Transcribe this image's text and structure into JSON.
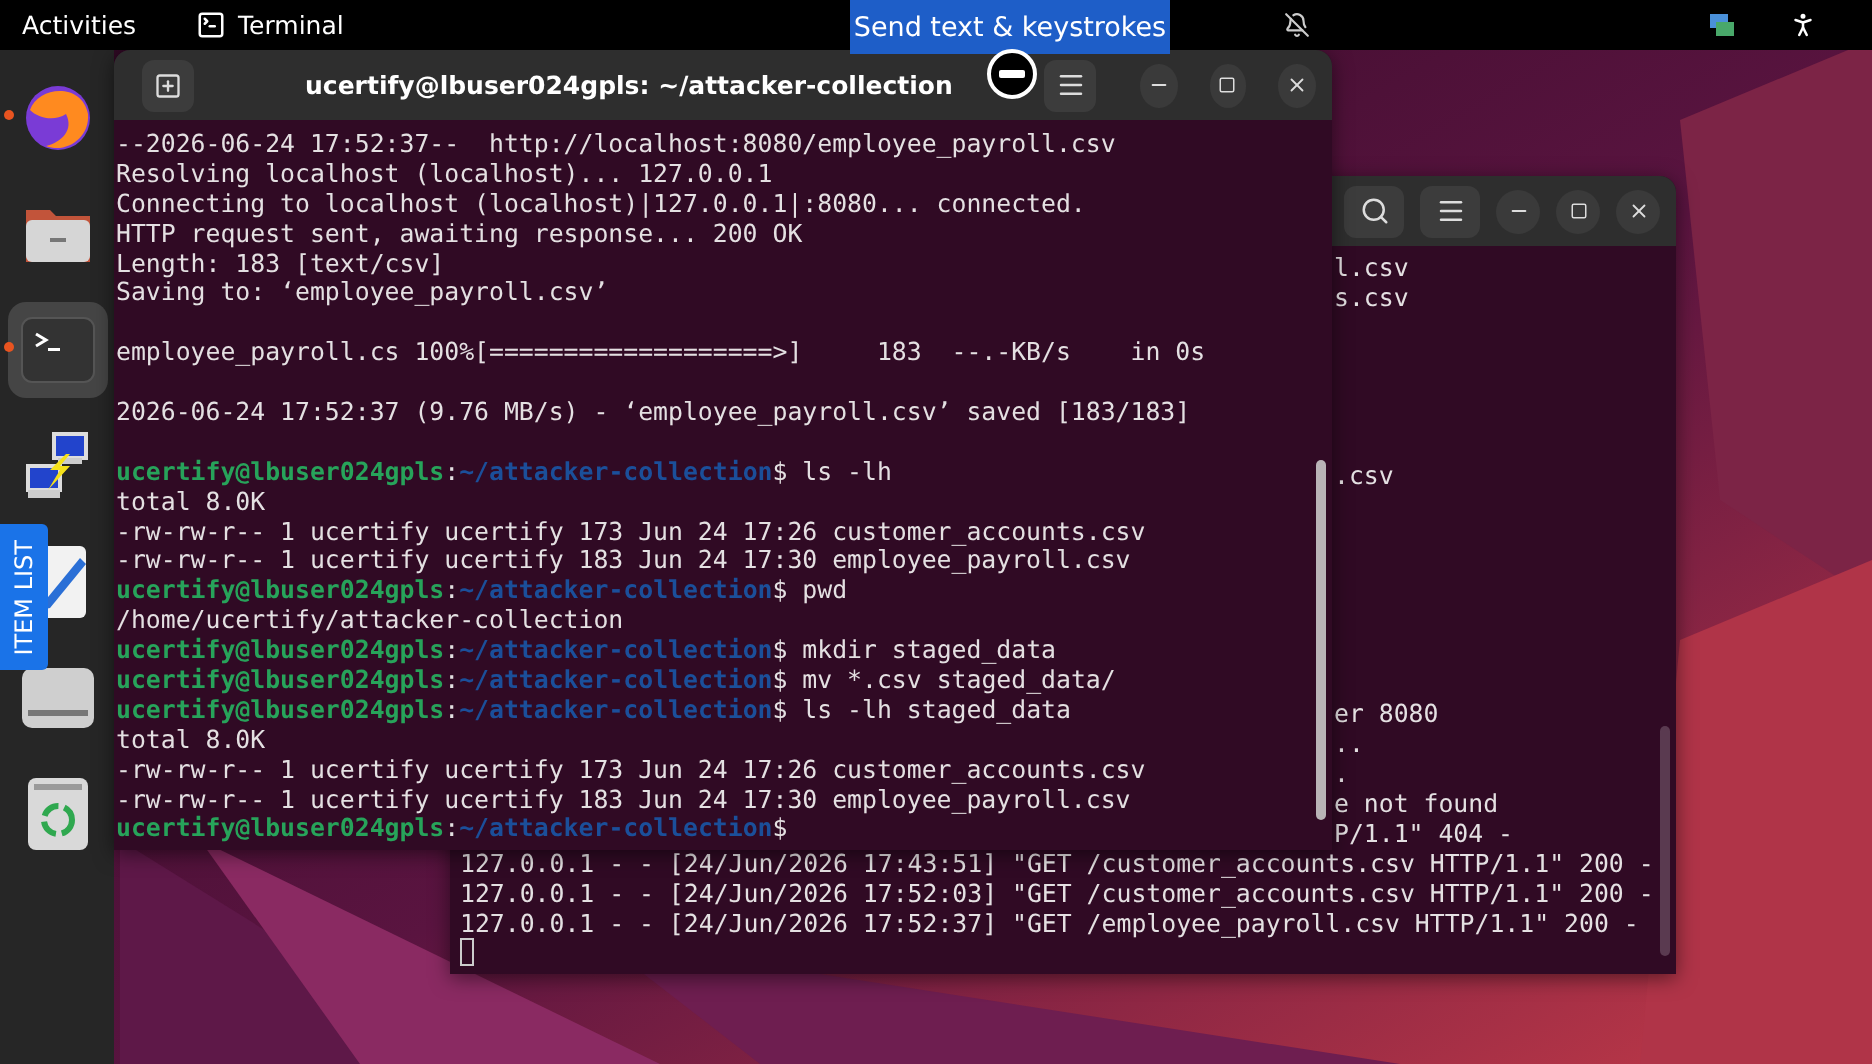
{
  "top_bar": {
    "activities": "Activities",
    "app_name": "Terminal"
  },
  "overlay": {
    "tooltip": "Send text & keystrokes",
    "side_tab": "ITEM LIST"
  },
  "dock": [
    {
      "kind": "browser",
      "running": true,
      "selected": false
    },
    {
      "kind": "folder",
      "running": false,
      "selected": false
    },
    {
      "kind": "terminal",
      "running": true,
      "selected": true
    },
    {
      "kind": "remote",
      "running": false,
      "selected": false
    },
    {
      "kind": "editor",
      "running": false,
      "selected": false
    },
    {
      "kind": "drive",
      "running": false,
      "selected": false
    },
    {
      "kind": "trash",
      "running": false,
      "selected": false
    }
  ],
  "front_terminal": {
    "title": "ucertify@lbuser024gpls: ~/attacker-collection",
    "lines": [
      {
        "kind": "output",
        "text": "--2026-06-24 17:52:37--  http://localhost:8080/employee_payroll.csv"
      },
      {
        "kind": "output",
        "text": "Resolving localhost (localhost)... 127.0.0.1"
      },
      {
        "kind": "output",
        "text": "Connecting to localhost (localhost)|127.0.0.1|:8080... connected."
      },
      {
        "kind": "output",
        "text": "HTTP request sent, awaiting response... 200 OK"
      },
      {
        "kind": "output",
        "text": "Length: 183 [text/csv]"
      },
      {
        "kind": "output",
        "text": "Saving to: ‘employee_payroll.csv’"
      },
      {
        "kind": "blank"
      },
      {
        "kind": "output",
        "text": "employee_payroll.cs 100%[===================>]     183  --.-KB/s    in 0s"
      },
      {
        "kind": "blank"
      },
      {
        "kind": "output",
        "text": "2026-06-24 17:52:37 (9.76 MB/s) - ‘employee_payroll.csv’ saved [183/183]"
      },
      {
        "kind": "blank"
      },
      {
        "kind": "prompt",
        "user": "ucertify@lbuser024gpls",
        "sep": ":",
        "path": "~/attacker-collection",
        "sign": "$",
        "command": "ls -lh"
      },
      {
        "kind": "output",
        "text": "total 8.0K"
      },
      {
        "kind": "output",
        "text": "-rw-rw-r-- 1 ucertify ucertify 173 Jun 24 17:26 customer_accounts.csv"
      },
      {
        "kind": "output",
        "text": "-rw-rw-r-- 1 ucertify ucertify 183 Jun 24 17:30 employee_payroll.csv"
      },
      {
        "kind": "prompt",
        "user": "ucertify@lbuser024gpls",
        "sep": ":",
        "path": "~/attacker-collection",
        "sign": "$",
        "command": "pwd"
      },
      {
        "kind": "output",
        "text": "/home/ucertify/attacker-collection"
      },
      {
        "kind": "prompt",
        "user": "ucertify@lbuser024gpls",
        "sep": ":",
        "path": "~/attacker-collection",
        "sign": "$",
        "command": "mkdir staged_data"
      },
      {
        "kind": "prompt",
        "user": "ucertify@lbuser024gpls",
        "sep": ":",
        "path": "~/attacker-collection",
        "sign": "$",
        "command": "mv *.csv staged_data/"
      },
      {
        "kind": "prompt",
        "user": "ucertify@lbuser024gpls",
        "sep": ":",
        "path": "~/attacker-collection",
        "sign": "$",
        "command": "ls -lh staged_data"
      },
      {
        "kind": "output",
        "text": "total 8.0K"
      },
      {
        "kind": "output",
        "text": "-rw-rw-r-- 1 ucertify ucertify 173 Jun 24 17:26 customer_accounts.csv"
      },
      {
        "kind": "output",
        "text": "-rw-rw-r-- 1 ucertify ucertify 183 Jun 24 17:30 employee_payroll.csv"
      },
      {
        "kind": "prompt",
        "user": "ucertify@lbuser024gpls",
        "sep": ":",
        "path": "~/attacker-collection",
        "sign": "$"
      }
    ]
  },
  "back_terminal": {
    "visible_tails": [
      {
        "kind": "text",
        "text": "l.csv"
      },
      {
        "kind": "text",
        "text": "s.csv"
      },
      {
        "kind": "blank"
      },
      {
        "kind": "blank"
      },
      {
        "kind": "blank"
      },
      {
        "kind": "blank"
      },
      {
        "kind": "blank"
      },
      {
        "kind": "text",
        "text": ".csv"
      },
      {
        "kind": "blank"
      },
      {
        "kind": "blank"
      },
      {
        "kind": "blank"
      },
      {
        "kind": "blank"
      },
      {
        "kind": "blank"
      },
      {
        "kind": "blank"
      },
      {
        "kind": "blank"
      },
      {
        "kind": "text",
        "text": "er 8080"
      },
      {
        "kind": "text",
        "text": ".."
      },
      {
        "kind": "text",
        "text": "."
      },
      {
        "kind": "text",
        "text": "e not found"
      },
      {
        "kind": "text",
        "text": "P/1.1\" 404 -"
      }
    ],
    "lines": [
      "127.0.0.1 - - [24/Jun/2026 17:43:51] \"GET /customer_accounts.csv HTTP/1.1\" 200 -",
      "127.0.0.1 - - [24/Jun/2026 17:52:03] \"GET /customer_accounts.csv HTTP/1.1\" 200 -",
      "127.0.0.1 - - [24/Jun/2026 17:52:37] \"GET /employee_payroll.csv HTTP/1.1\" 200 -"
    ],
    "cursor_visible": true
  }
}
